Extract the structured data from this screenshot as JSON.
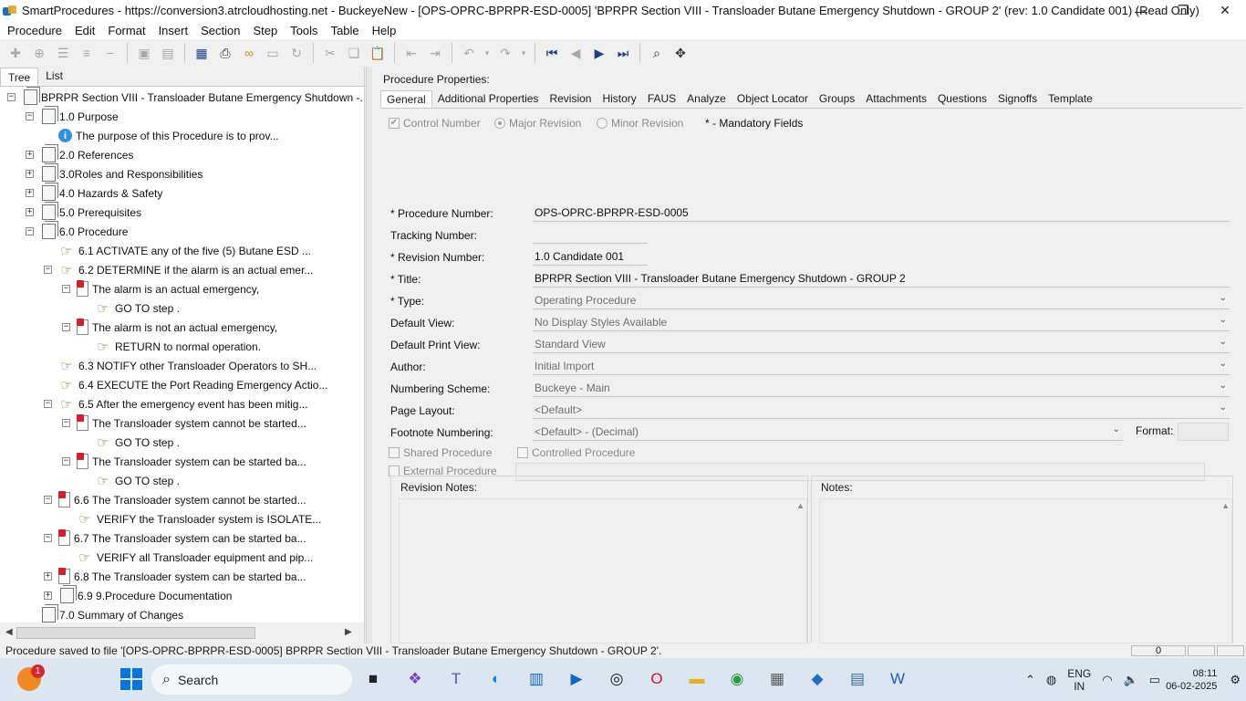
{
  "window": {
    "title": "SmartProcedures - https://conversion3.atrcloudhosting.net - BuckeyeNew - [OPS-OPRC-BPRPR-ESD-0005] 'BPRPR Section VIII - Transloader Butane Emergency Shutdown - GROUP 2' (rev: 1.0 Candidate 001) (Read Only)",
    "minimize": "—",
    "restore": "❐",
    "close": "✕"
  },
  "menu": [
    "Procedure",
    "Edit",
    "Format",
    "Insert",
    "Section",
    "Step",
    "Tools",
    "Table",
    "Help"
  ],
  "left": {
    "tabs": [
      "Tree",
      "List"
    ],
    "tree": [
      {
        "indent": 0,
        "toggle": "−",
        "icon": "doc",
        "label": "BPRPR Section VIII - Transloader Butane Emergency Shutdown -..."
      },
      {
        "indent": 1,
        "toggle": "−",
        "icon": "doc",
        "label": "1.0 Purpose"
      },
      {
        "indent": 2,
        "toggle": "",
        "icon": "info",
        "label": "The purpose of this Procedure is to prov..."
      },
      {
        "indent": 1,
        "toggle": "+",
        "icon": "doc",
        "label": "2.0 References"
      },
      {
        "indent": 1,
        "toggle": "+",
        "icon": "doc",
        "label": "3.0Roles and Responsibilities"
      },
      {
        "indent": 1,
        "toggle": "+",
        "icon": "doc",
        "label": "4.0 Hazards & Safety"
      },
      {
        "indent": 1,
        "toggle": "+",
        "icon": "doc",
        "label": "5.0 Prerequisites"
      },
      {
        "indent": 1,
        "toggle": "−",
        "icon": "doc",
        "label": "6.0 Procedure"
      },
      {
        "indent": 2,
        "toggle": "",
        "icon": "hand",
        "label": "6.1 ACTIVATE any of the five (5) Butane ESD ..."
      },
      {
        "indent": 2,
        "toggle": "−",
        "icon": "hand",
        "label": "6.2 DETERMINE if the alarm is an actual emer..."
      },
      {
        "indent": 3,
        "toggle": "−",
        "icon": "cond",
        "label": "The alarm is an actual emergency,"
      },
      {
        "indent": 4,
        "toggle": "",
        "icon": "hand",
        "label": "GO TO step ."
      },
      {
        "indent": 3,
        "toggle": "−",
        "icon": "cond",
        "label": "The alarm is not an actual emergency,"
      },
      {
        "indent": 4,
        "toggle": "",
        "icon": "hand",
        "label": "RETURN to normal operation."
      },
      {
        "indent": 2,
        "toggle": "",
        "icon": "hand",
        "label": "6.3 NOTIFY other Transloader Operators to SH..."
      },
      {
        "indent": 2,
        "toggle": "",
        "icon": "hand",
        "label": "6.4 EXECUTE the Port Reading Emergency Actio..."
      },
      {
        "indent": 2,
        "toggle": "−",
        "icon": "hand",
        "label": "6.5 After the emergency event has been mitig..."
      },
      {
        "indent": 3,
        "toggle": "−",
        "icon": "cond",
        "label": "The Transloader system cannot be started..."
      },
      {
        "indent": 4,
        "toggle": "",
        "icon": "hand",
        "label": "GO TO step ."
      },
      {
        "indent": 3,
        "toggle": "−",
        "icon": "cond",
        "label": "The Transloader system can be started ba..."
      },
      {
        "indent": 4,
        "toggle": "",
        "icon": "hand",
        "label": "GO TO step ."
      },
      {
        "indent": 2,
        "toggle": "−",
        "icon": "cond",
        "label": "6.6 The Transloader system cannot be started..."
      },
      {
        "indent": 3,
        "toggle": "",
        "icon": "hand",
        "label": "VERIFY the Transloader system is ISOLATE..."
      },
      {
        "indent": 2,
        "toggle": "−",
        "icon": "cond",
        "label": "6.7 The Transloader system can be started ba..."
      },
      {
        "indent": 3,
        "toggle": "",
        "icon": "hand",
        "label": "VERIFY all Transloader equipment and pip..."
      },
      {
        "indent": 2,
        "toggle": "+",
        "icon": "cond",
        "label": "6.8 The Transloader system can be started ba..."
      },
      {
        "indent": 2,
        "toggle": "+",
        "icon": "doc",
        "label": "6.9  9.Procedure Documentation"
      },
      {
        "indent": 1,
        "toggle": "",
        "icon": "doc",
        "label": "7.0 Summary of Changes"
      }
    ]
  },
  "properties": {
    "header": "Procedure Properties:",
    "tabs": [
      "General",
      "Additional Properties",
      "Revision",
      "History",
      "FAUS",
      "Analyze",
      "Object Locator",
      "Groups",
      "Attachments",
      "Questions",
      "Signoffs",
      "Template"
    ],
    "options": {
      "control_number": "Control Number",
      "major_revision": "Major Revision",
      "minor_revision": "Minor Revision",
      "mandatory_note": "* - Mandatory Fields"
    },
    "fields": [
      {
        "label": "* Procedure Number:",
        "value": "OPS-OPRC-BPRPR-ESD-0005",
        "dropdown": ""
      },
      {
        "label": "Tracking Number:",
        "value": "",
        "dropdown": ""
      },
      {
        "label": "* Revision Number:",
        "value": "1.0 Candidate 001",
        "dropdown": ""
      },
      {
        "label": "* Title:",
        "value": "BPRPR Section VIII - Transloader Butane Emergency Shutdown - GROUP 2",
        "dropdown": ""
      },
      {
        "label": "* Type:",
        "value": "Operating Procedure",
        "dropdown": "⌄"
      },
      {
        "label": "Default View:",
        "value": "No Display Styles Available",
        "dropdown": "⌄"
      },
      {
        "label": "Default Print View:",
        "value": "Standard View",
        "dropdown": "⌄"
      },
      {
        "label": "Author:",
        "value": "Initial Import",
        "dropdown": "⌄"
      },
      {
        "label": "Numbering Scheme:",
        "value": "Buckeye - Main",
        "dropdown": "⌄"
      },
      {
        "label": "Page Layout:",
        "value": "<Default>",
        "dropdown": "⌄"
      },
      {
        "label": "Footnote Numbering:",
        "value": "<Default> - (Decimal)",
        "dropdown": "⌄"
      }
    ],
    "format_label": "Format:",
    "shared_procedure": "Shared Procedure",
    "controlled_procedure": "Controlled Procedure",
    "external_procedure": "External Procedure",
    "revision_notes": "Revision Notes:",
    "notes": "Notes:"
  },
  "status": {
    "message": "Procedure saved to file '[OPS-OPRC-BPRPR-ESD-0005] BPRPR Section VIII - Transloader Butane Emergency Shutdown - GROUP 2'.",
    "panel_value": "0"
  },
  "taskbar": {
    "search_placeholder": "Search",
    "notification_count": "1",
    "language": "ENG",
    "region": "IN",
    "time": "08:11",
    "date": "06-02-2025"
  }
}
